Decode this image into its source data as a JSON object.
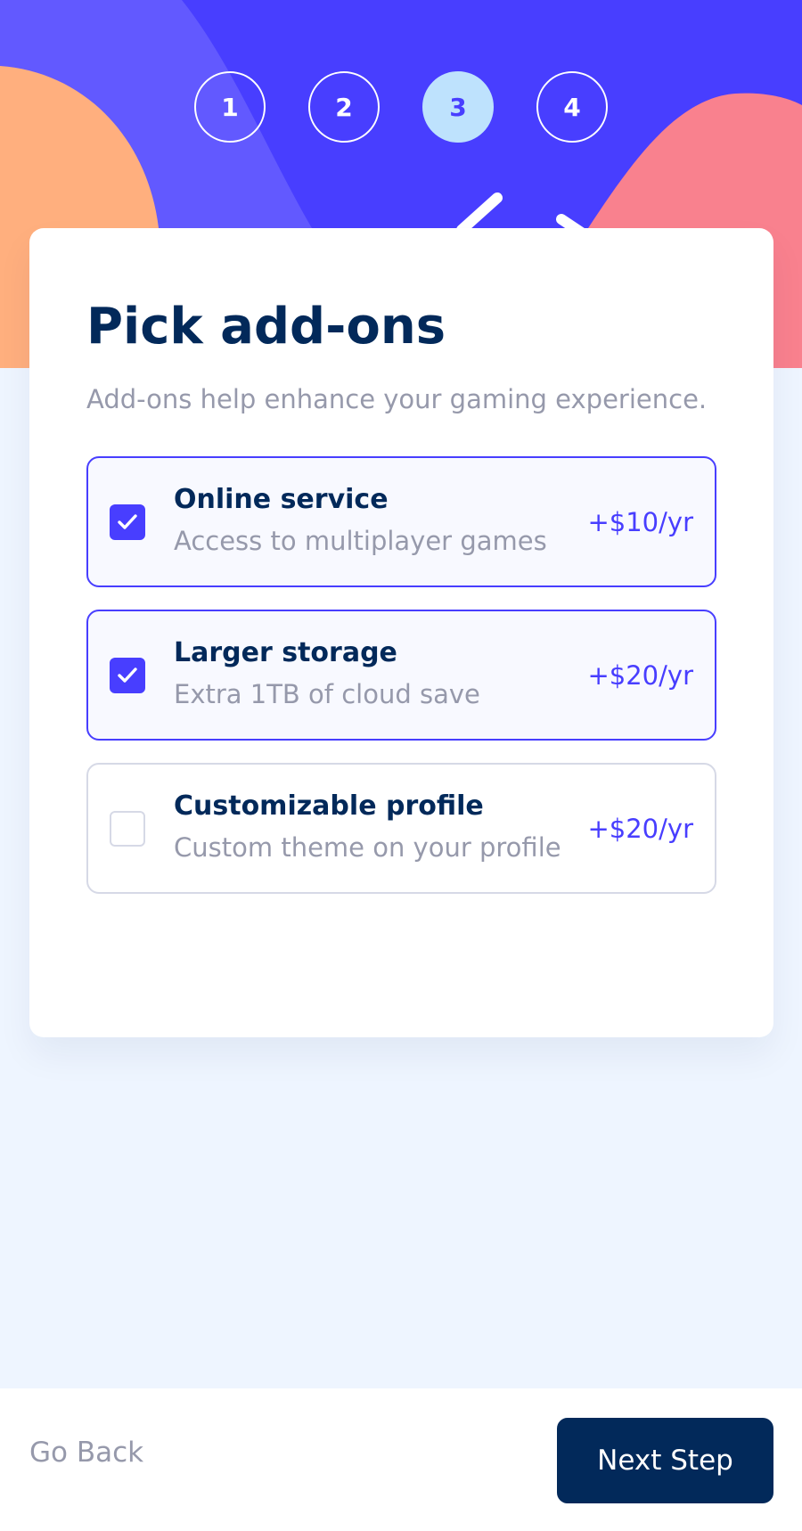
{
  "steps": [
    "1",
    "2",
    "3",
    "4"
  ],
  "active_step": "3",
  "form": {
    "title": "Pick add-ons",
    "subtitle": "Add-ons help enhance your gaming experience."
  },
  "addons": [
    {
      "name": "Online service",
      "description": "Access to multiplayer games",
      "price": "+$10/yr",
      "checked": true
    },
    {
      "name": "Larger storage",
      "description": "Extra 1TB of cloud save",
      "price": "+$20/yr",
      "checked": true
    },
    {
      "name": "Customizable profile",
      "description": "Custom theme on your profile",
      "price": "+$20/yr",
      "checked": false
    }
  ],
  "footer": {
    "back_label": "Go Back",
    "next_label": "Next Step"
  },
  "colors": {
    "marine_blue": "#02295a",
    "purplish_blue": "#483eff",
    "pastel_blue": "#bee2fd",
    "light_orange": "#ffaf7e",
    "light_red": "#f9818e",
    "cool_gray": "#9699ab",
    "magnolia": "#f8f9ff",
    "light_gray": "#d6d9e6",
    "alabaster": "#eef5ff"
  },
  "icons": [
    "checkmark-icon"
  ]
}
